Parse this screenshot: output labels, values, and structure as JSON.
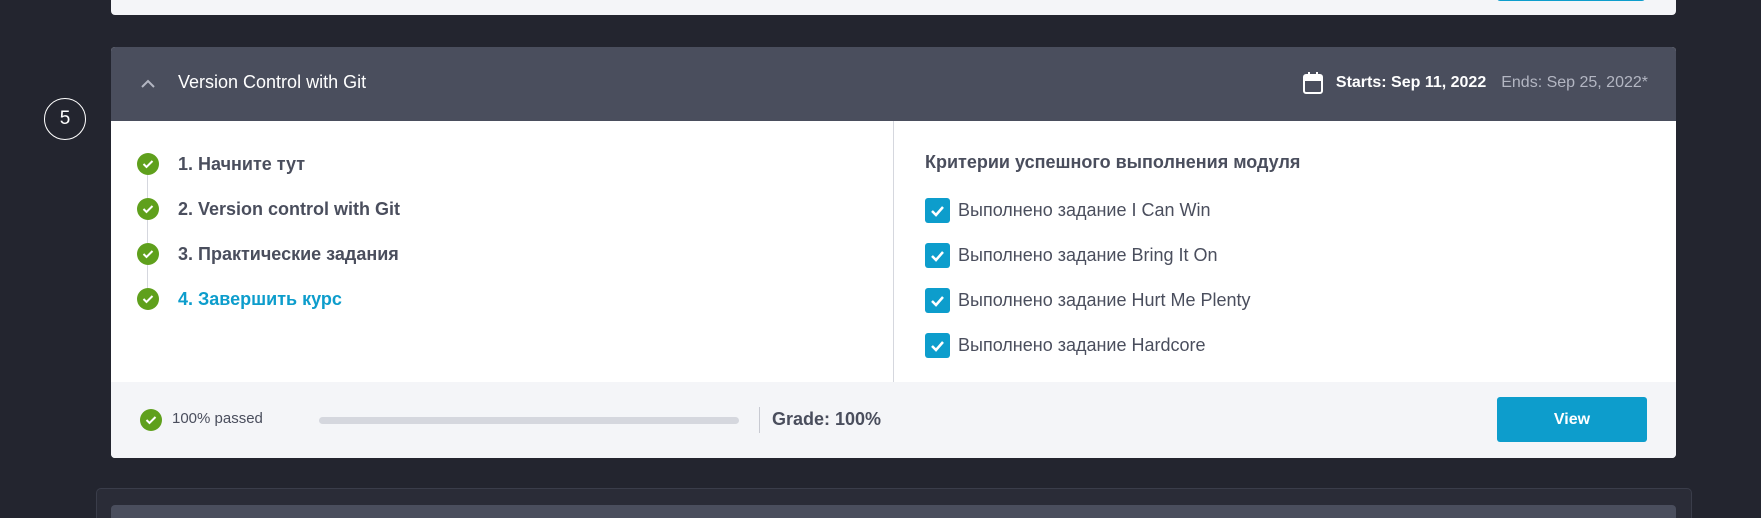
{
  "step_number": "5",
  "module": {
    "title": "Version Control with Git",
    "starts": "Starts: Sep 11, 2022",
    "ends": "Ends: Sep 25, 2022*",
    "steps": [
      {
        "label": "1. Начните тут",
        "done": true
      },
      {
        "label": "2. Version control with Git",
        "done": true
      },
      {
        "label": "3. Практические задания",
        "done": true
      },
      {
        "label": "4. Завершить курс",
        "done": true,
        "active": true
      }
    ],
    "criteria_title": "Критерии успешного выполнения модуля",
    "criteria": [
      {
        "label": "Выполнено задание I Can Win",
        "checked": true
      },
      {
        "label": "Выполнено задание Bring It On",
        "checked": true
      },
      {
        "label": "Выполнено задание Hurt Me Plenty",
        "checked": true
      },
      {
        "label": "Выполнено задание Hardcore",
        "checked": true
      }
    ],
    "footer": {
      "passed_text": "100% passed",
      "progress_fraction": 1.0,
      "grade_text": "Grade: 100%",
      "view_label": "View"
    }
  },
  "colors": {
    "background": "#23252f",
    "header": "#4a4e5d",
    "accent": "#0d9dcc",
    "success": "#5fa01c"
  }
}
